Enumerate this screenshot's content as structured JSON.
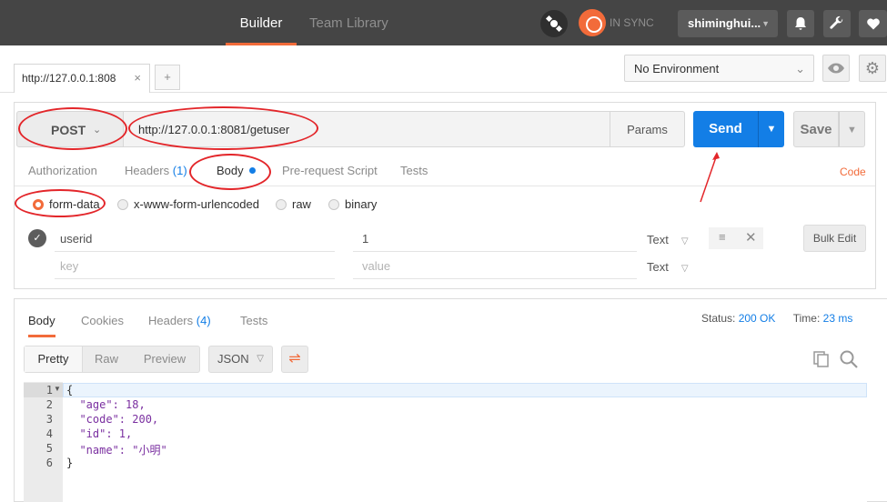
{
  "topbar": {
    "tabs": [
      "Builder",
      "Team Library"
    ],
    "sync_status": "IN SYNC",
    "username": "shiminghui...",
    "icons": [
      "satellite-icon",
      "sync-icon",
      "bell-icon",
      "wrench-icon",
      "heart-icon"
    ]
  },
  "request_tab": {
    "title": "http://127.0.0.1:808",
    "close": "×",
    "new_tab": "+"
  },
  "environment": {
    "selected": "No Environment"
  },
  "request": {
    "method": "POST",
    "url": "http://127.0.0.1:8081/getuser",
    "params_label": "Params",
    "send_label": "Send",
    "save_label": "Save",
    "tabs": {
      "authorization": "Authorization",
      "headers": "Headers",
      "headers_count": "(1)",
      "body": "Body",
      "prerequest": "Pre-request Script",
      "tests": "Tests"
    },
    "code_label": "Code",
    "body_modes": [
      "form-data",
      "x-www-form-urlencoded",
      "raw",
      "binary"
    ],
    "selected_mode": "form-data",
    "rows": [
      {
        "key": "userid",
        "value": "1",
        "type": "Text"
      },
      {
        "key_placeholder": "key",
        "value_placeholder": "value",
        "type": "Text"
      }
    ],
    "bulk_edit_label": "Bulk Edit"
  },
  "response": {
    "tabs": {
      "body": "Body",
      "cookies": "Cookies",
      "headers": "Headers",
      "headers_count": "(4)",
      "tests": "Tests"
    },
    "status_label": "Status:",
    "status_value": "200 OK",
    "time_label": "Time:",
    "time_value": "23 ms",
    "formats": [
      "Pretty",
      "Raw",
      "Preview"
    ],
    "language": "JSON",
    "line_numbers": [
      "1",
      "2",
      "3",
      "4",
      "5",
      "6"
    ],
    "code_lines": [
      "{",
      "  \"age\": 18,",
      "  \"code\": 200,",
      "  \"id\": 1,",
      "  \"name\": \"小明\"",
      "}"
    ]
  },
  "colors": {
    "accent": "#f26b3a",
    "send_blue": "#137ee6",
    "topbar": "#454545",
    "annotation_red": "#e3262a"
  }
}
